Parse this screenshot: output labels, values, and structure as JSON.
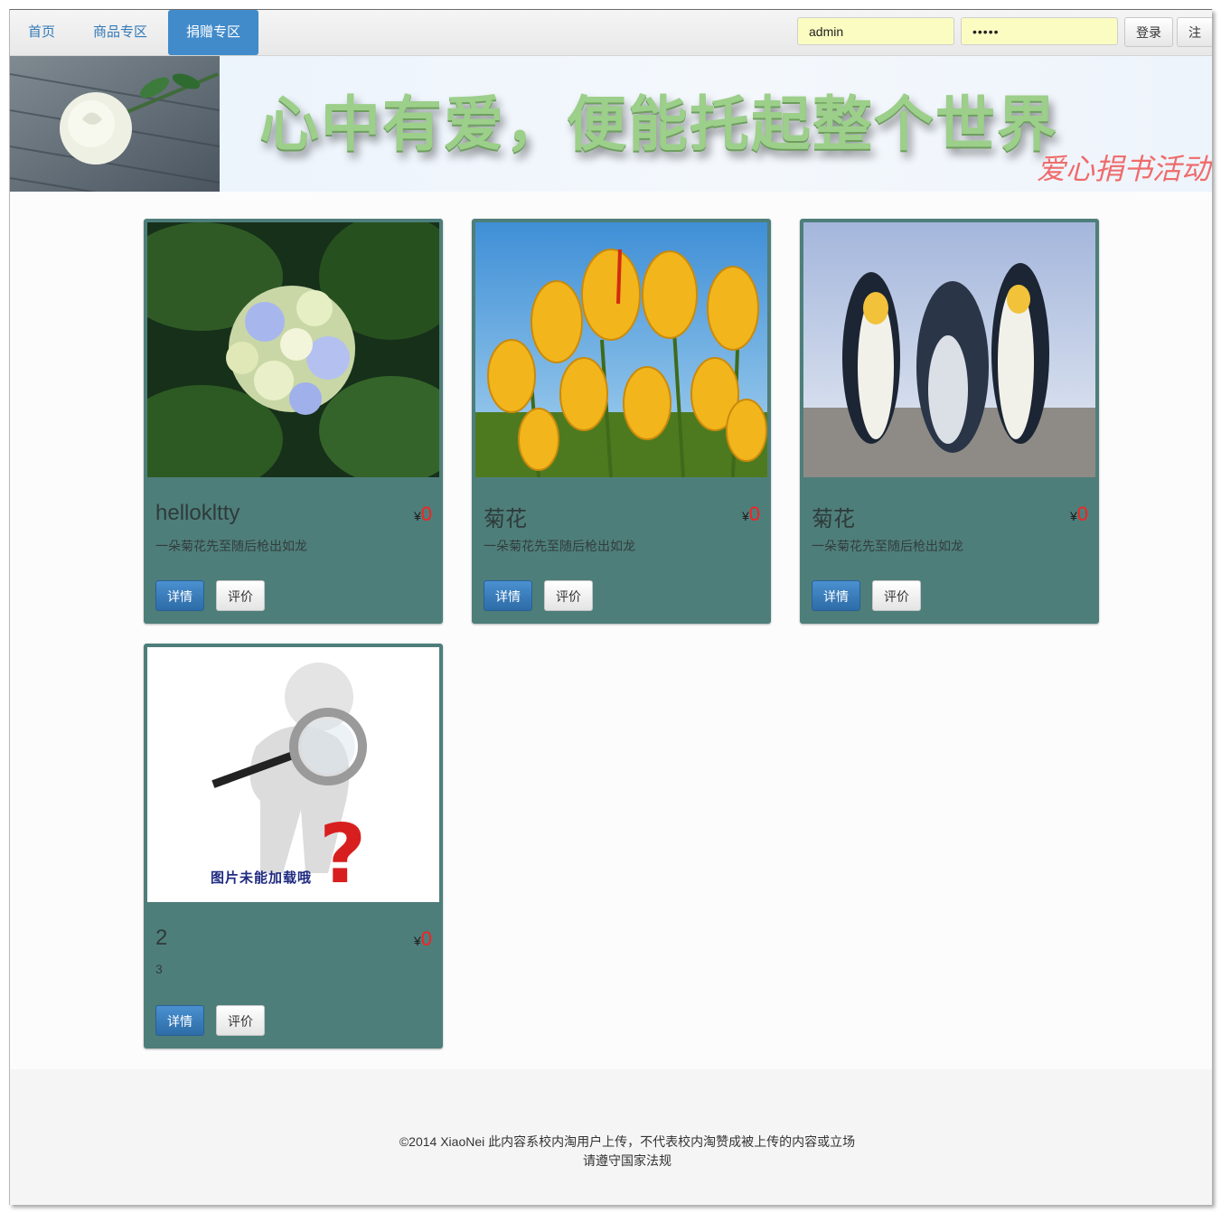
{
  "navbar": {
    "items": [
      {
        "label": "首页"
      },
      {
        "label": "商品专区"
      },
      {
        "label": "捐赠专区"
      }
    ],
    "active_index": 2,
    "username_value": "admin",
    "password_value": "•••••",
    "login_label": "登录",
    "register_label": "注册"
  },
  "banner": {
    "slogan": "心中有爱，便能托起整个世界",
    "subtitle": "爱心捐书活动"
  },
  "cards": [
    {
      "title": "hellokltty",
      "currency": "¥",
      "price": "0",
      "desc": "一朵菊花先至随后枪出如龙",
      "detail_label": "详情",
      "review_label": "评价",
      "image": "hydrangea"
    },
    {
      "title": "菊花",
      "currency": "¥",
      "price": "0",
      "desc": "一朵菊花先至随后枪出如龙",
      "detail_label": "详情",
      "review_label": "评价",
      "image": "tulips"
    },
    {
      "title": "菊花",
      "currency": "¥",
      "price": "0",
      "desc": "一朵菊花先至随后枪出如龙",
      "detail_label": "详情",
      "review_label": "评价",
      "image": "penguins"
    },
    {
      "title": "2",
      "currency": "¥",
      "price": "0",
      "desc": "3",
      "detail_label": "详情",
      "review_label": "评价",
      "image": "image-not-loaded",
      "placeholder_text": "图片未能加载哦"
    }
  ],
  "footer": {
    "line1": "©2014 XiaoNei 此内容系校内淘用户上传，不代表校内淘赞成被上传的内容或立场",
    "line2": "请遵守国家法规"
  },
  "colors": {
    "card_bg": "#4e7e7a",
    "nav_active": "#428bca",
    "price": "#ff1e1e",
    "detail_button": "#337ab7"
  }
}
